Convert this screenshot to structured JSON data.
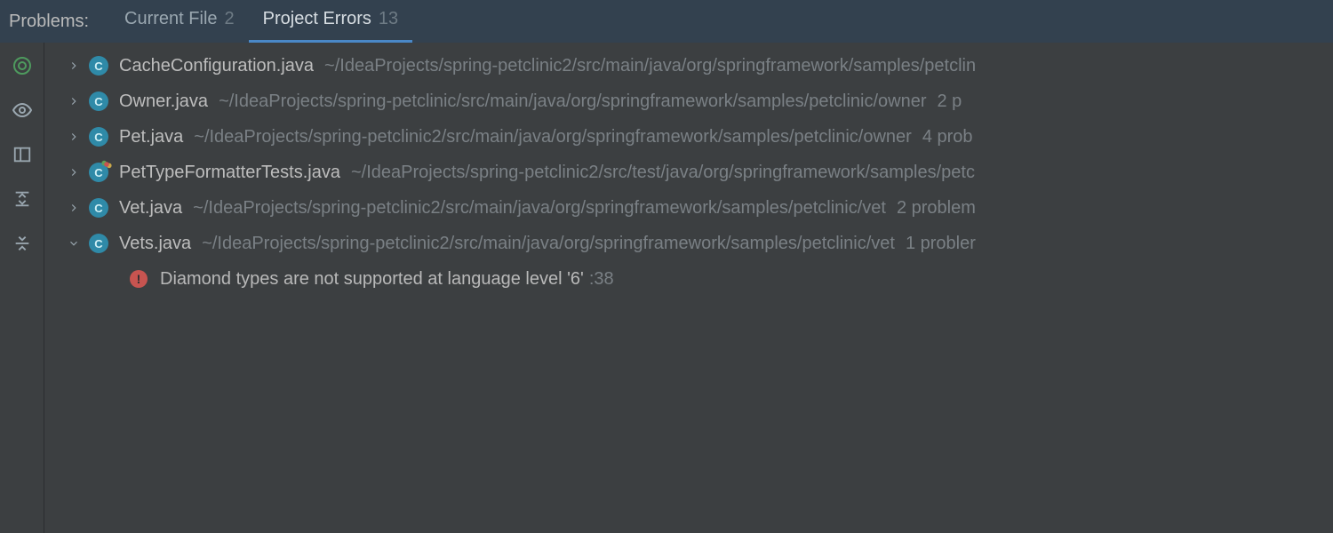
{
  "header": {
    "label": "Problems:",
    "tabs": [
      {
        "label": "Current File",
        "count": "2",
        "active": false
      },
      {
        "label": "Project Errors",
        "count": "13",
        "active": true
      }
    ]
  },
  "gutter_icons": [
    "target-icon",
    "eye-icon",
    "layout-icon",
    "expand-all-icon",
    "collapse-all-icon"
  ],
  "files": [
    {
      "name": "CacheConfiguration.java",
      "path": "~/IdeaProjects/spring-petclinic2/src/main/java/org/springframework/samples/petclin",
      "suffix": "",
      "expanded": false,
      "icon": "class"
    },
    {
      "name": "Owner.java",
      "path": "~/IdeaProjects/spring-petclinic/src/main/java/org/springframework/samples/petclinic/owner",
      "suffix": "2 p",
      "expanded": false,
      "icon": "class"
    },
    {
      "name": "Pet.java",
      "path": "~/IdeaProjects/spring-petclinic2/src/main/java/org/springframework/samples/petclinic/owner",
      "suffix": "4 prob",
      "expanded": false,
      "icon": "class"
    },
    {
      "name": "PetTypeFormatterTests.java",
      "path": "~/IdeaProjects/spring-petclinic2/src/test/java/org/springframework/samples/petc",
      "suffix": "",
      "expanded": false,
      "icon": "class-mod"
    },
    {
      "name": "Vet.java",
      "path": "~/IdeaProjects/spring-petclinic2/src/main/java/org/springframework/samples/petclinic/vet",
      "suffix": "2 problem",
      "expanded": false,
      "icon": "class"
    },
    {
      "name": "Vets.java",
      "path": "~/IdeaProjects/spring-petclinic2/src/main/java/org/springframework/samples/petclinic/vet",
      "suffix": "1 probler",
      "expanded": true,
      "icon": "class",
      "errors": [
        {
          "message": "Diamond types are not supported at language level '6'",
          "location": ":38"
        }
      ]
    }
  ],
  "icon_letter": "C"
}
